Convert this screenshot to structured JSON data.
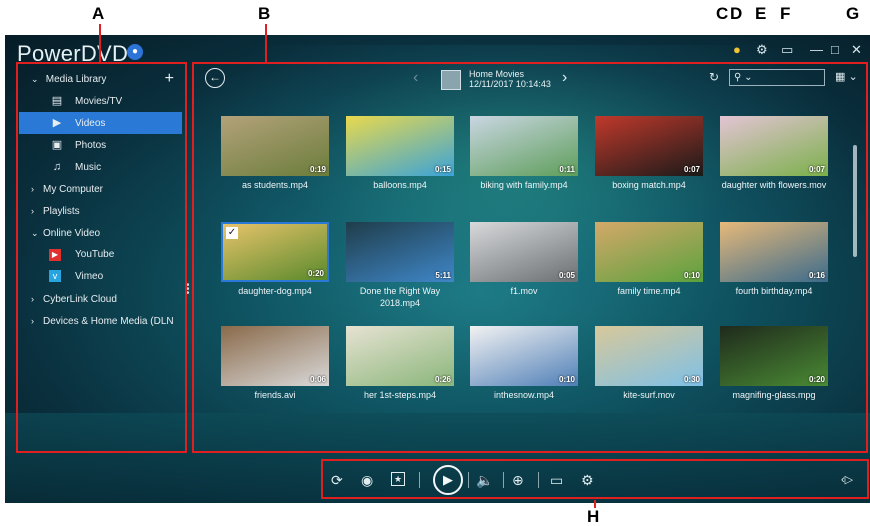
{
  "callouts": {
    "A": "A",
    "B": "B",
    "C": "C",
    "D": "D",
    "E": "E",
    "F": "F",
    "G": "G",
    "H": "H"
  },
  "app": {
    "title": "PowerDVD",
    "badge_icon": "bell-icon"
  },
  "window_controls": [
    "minimize-icon",
    "maximize-icon",
    "close-icon"
  ],
  "sidebar": {
    "items": [
      {
        "label": "Media Library",
        "level": 0,
        "expanded": true
      },
      {
        "label": "Movies/TV",
        "level": 1,
        "icon": "film-icon"
      },
      {
        "label": "Videos",
        "level": 1,
        "icon": "video-camera-icon",
        "selected": true
      },
      {
        "label": "Photos",
        "level": 1,
        "icon": "photo-icon"
      },
      {
        "label": "Music",
        "level": 1,
        "icon": "music-note-icon"
      },
      {
        "label": "My Computer",
        "level": 0
      },
      {
        "label": "Playlists",
        "level": 0
      },
      {
        "label": "Online Video",
        "level": 0,
        "expanded": true
      },
      {
        "label": "YouTube",
        "level": 1,
        "icon": "youtube-icon"
      },
      {
        "label": "Vimeo",
        "level": 1,
        "icon": "vimeo-icon"
      },
      {
        "label": "CyberLink Cloud",
        "level": 0
      },
      {
        "label": "Devices & Home Media (DLN",
        "level": 0
      }
    ]
  },
  "toolbar": {
    "folder_title": "Home Movies",
    "folder_date": "12/11/2017 10:14:43",
    "search_placeholder": "",
    "view_mode": "grid-icon"
  },
  "videos": [
    {
      "name": "as students.mp4",
      "duration": "0:19"
    },
    {
      "name": "balloons.mp4",
      "duration": "0:15"
    },
    {
      "name": "biking with family.mp4",
      "duration": "0:11"
    },
    {
      "name": "boxing match.mp4",
      "duration": "0:07"
    },
    {
      "name": "daughter with flowers.mov",
      "duration": "0:07"
    },
    {
      "name": "daughter-dog.mp4",
      "duration": "0:20",
      "checked": true
    },
    {
      "name": "Done the Right Way 2018.mp4",
      "duration": "5:11"
    },
    {
      "name": "f1.mov",
      "duration": "0:05"
    },
    {
      "name": "family time.mp4",
      "duration": "0:10"
    },
    {
      "name": "fourth birthday.mp4",
      "duration": "0:16"
    },
    {
      "name": "friends.avi",
      "duration": "0:06"
    },
    {
      "name": "her 1st-steps.mp4",
      "duration": "0:26"
    },
    {
      "name": "inthesnow.mp4",
      "duration": "0:10"
    },
    {
      "name": "kite-surf.mov",
      "duration": "0:30"
    },
    {
      "name": "magnifing-glass.mpg",
      "duration": "0:20"
    }
  ],
  "playback_bar": [
    "repeat-icon",
    "eye-icon",
    "star-icon",
    "play-icon",
    "volume-icon",
    "zoom-icon",
    "vr-headset-icon",
    "settings-icon",
    "expand-player-icon"
  ],
  "colors": {
    "accent": "#2b79d6",
    "callout_frame": "#e02020"
  }
}
